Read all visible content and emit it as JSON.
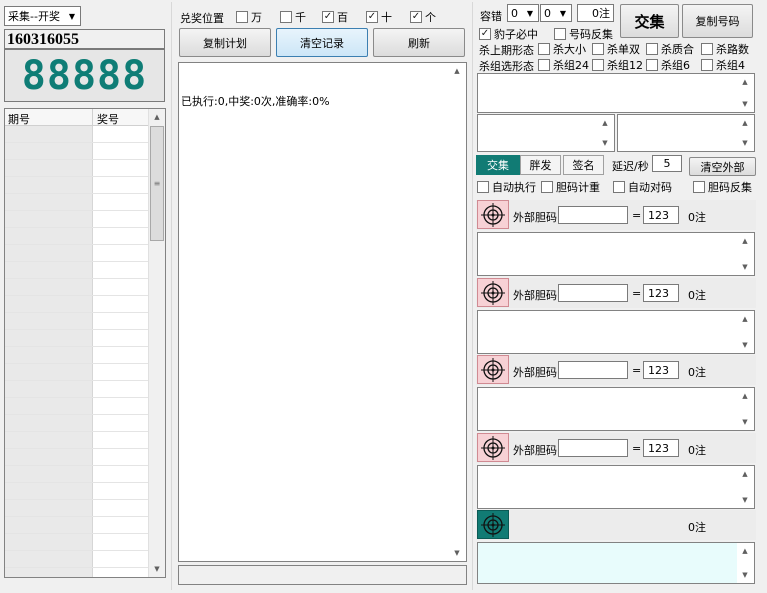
{
  "left": {
    "source_combo": "采集--开奖",
    "issue_number": "160316055",
    "draw_number": "88888",
    "table_headers": [
      "期号",
      "奖号"
    ]
  },
  "middle": {
    "positions_label": "兑奖位置",
    "positions": [
      {
        "label": "万",
        "checked": false
      },
      {
        "label": "千",
        "checked": false
      },
      {
        "label": "百",
        "checked": true
      },
      {
        "label": "十",
        "checked": true
      },
      {
        "label": "个",
        "checked": true
      }
    ],
    "copy_plan_button": "复制计划",
    "clear_records_button": "清空记录",
    "refresh_button": "刷新",
    "log_text": "已执行:0,中奖:0次,准确率:0%"
  },
  "right": {
    "tolerance_label": "容错",
    "tolerance_a": "0",
    "tolerance_b": "0",
    "count_display": "0注",
    "intersect_button": "交集",
    "copy_number_button": "复制号码",
    "leopard_label": "豹子必中",
    "leopard_checked": true,
    "number_invert_label": "号码反集",
    "number_invert_checked": false,
    "kill_last_label": "杀上期形态",
    "kill_last_options": [
      "杀大小",
      "杀单双",
      "杀质合",
      "杀路数"
    ],
    "kill_group_label": "杀组选形态",
    "kill_group_options": [
      "杀组24",
      "杀组12",
      "杀组6",
      "杀组4"
    ],
    "tabs": [
      "交集",
      "胖发",
      "签名"
    ],
    "delay_label": "延迟/秒",
    "delay_value": "5",
    "clear_external_button": "清空外部",
    "options": [
      "自动执行",
      "胆码计重",
      "自动对码",
      "胆码反集"
    ],
    "external_groups": [
      {
        "label": "外部胆码",
        "eq": "=",
        "value": "123",
        "count": "0注"
      },
      {
        "label": "外部胆码",
        "eq": "=",
        "value": "123",
        "count": "0注"
      },
      {
        "label": "外部胆码",
        "eq": "=",
        "value": "123",
        "count": "0注"
      },
      {
        "label": "外部胆码",
        "eq": "=",
        "value": "123",
        "count": "0注"
      }
    ],
    "final_count": "0注"
  }
}
